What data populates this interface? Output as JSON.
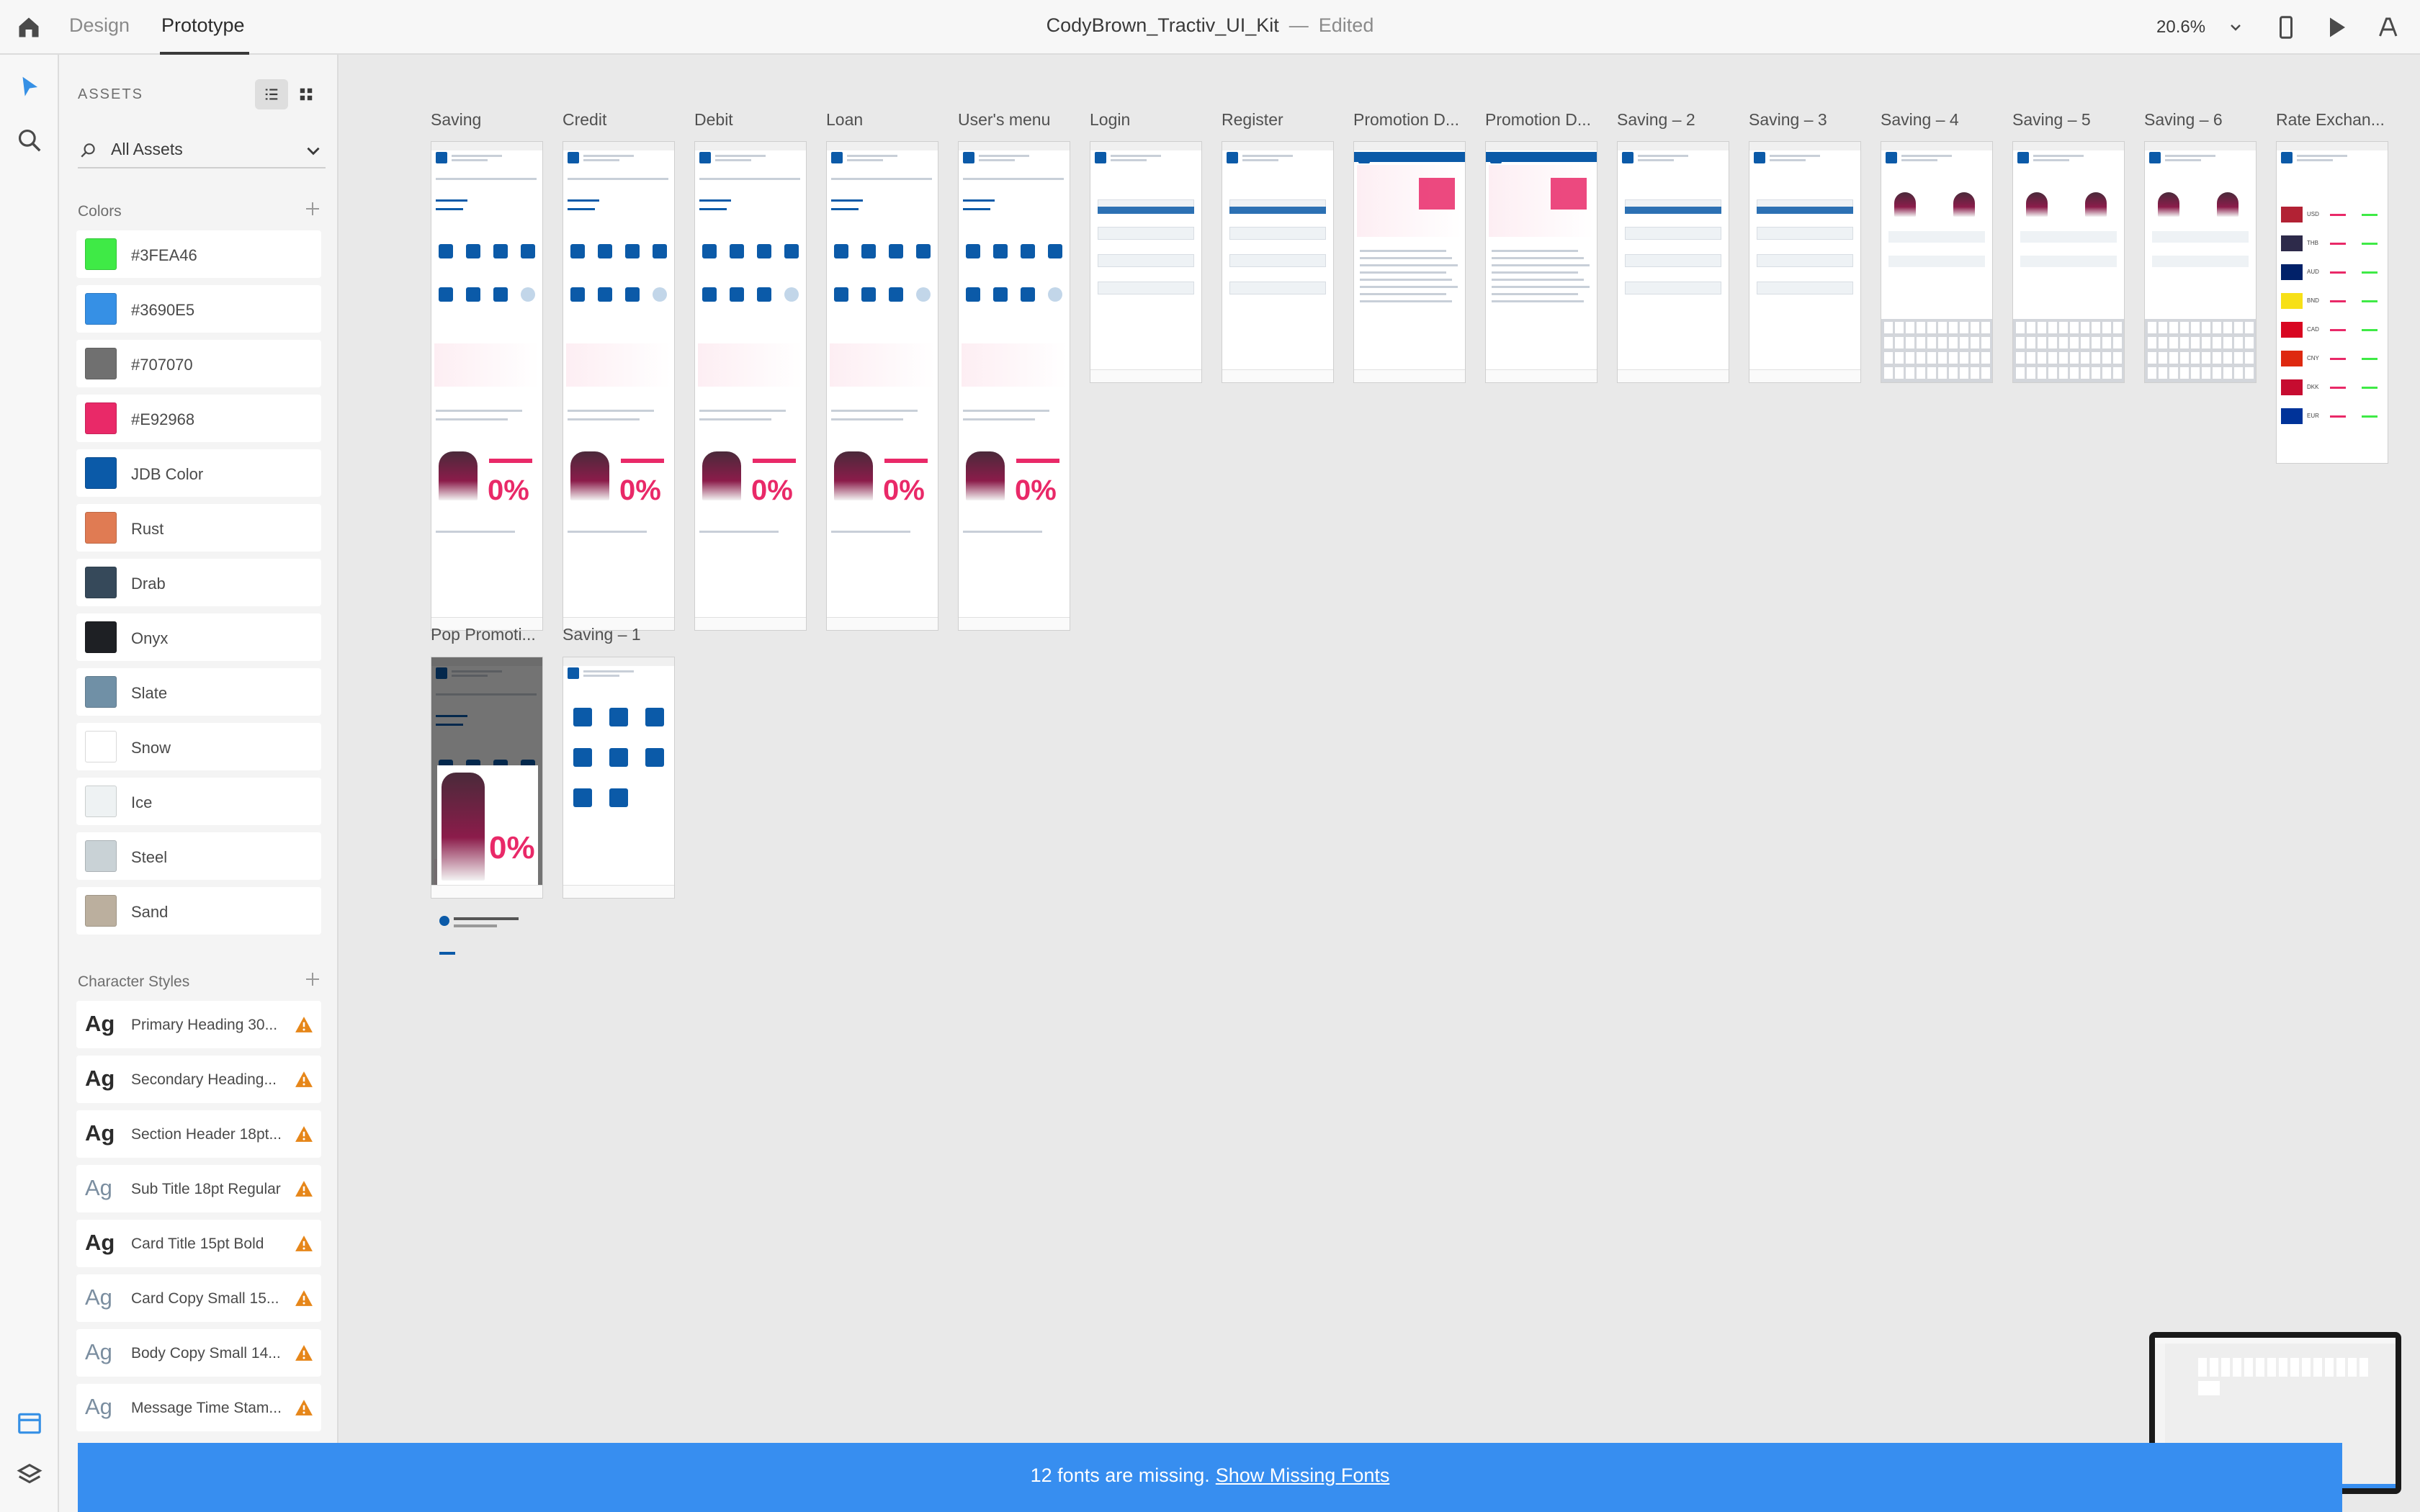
{
  "app": {
    "modes": [
      "Design",
      "Prototype"
    ],
    "active_mode": "Prototype",
    "document_title": "CodyBrown_Tractiv_UI_Kit",
    "separator": "—",
    "document_status": "Edited",
    "zoom": "20.6%"
  },
  "assets_panel": {
    "title": "ASSETS",
    "filter_label": "All Assets",
    "colors_title": "Colors",
    "colors": [
      {
        "label": "#3FEA46",
        "hex": "#3FEA46"
      },
      {
        "label": "#3690E5",
        "hex": "#3690E5"
      },
      {
        "label": "#707070",
        "hex": "#707070"
      },
      {
        "label": "#E92968",
        "hex": "#E92968"
      },
      {
        "label": "JDB Color",
        "hex": "#0B5AA8"
      },
      {
        "label": "Rust",
        "hex": "#E07B53"
      },
      {
        "label": "Drab",
        "hex": "#36495A"
      },
      {
        "label": "Onyx",
        "hex": "#1E2024"
      },
      {
        "label": "Slate",
        "hex": "#7090A6"
      },
      {
        "label": "Snow",
        "hex": "#FFFFFF"
      },
      {
        "label": "Ice",
        "hex": "#EEF2F3"
      },
      {
        "label": "Steel",
        "hex": "#C9D2D6"
      },
      {
        "label": "Sand",
        "hex": "#BBAF9E"
      }
    ],
    "char_styles_title": "Character Styles",
    "char_styles": [
      {
        "sample": "Ag",
        "label": "Primary Heading 30...",
        "weight": "bold"
      },
      {
        "sample": "Ag",
        "label": "Secondary Heading...",
        "weight": "bold"
      },
      {
        "sample": "Ag",
        "label": "Section Header 18pt...",
        "weight": "bold"
      },
      {
        "sample": "Ag",
        "label": "Sub Title 18pt Regular",
        "weight": "light"
      },
      {
        "sample": "Ag",
        "label": "Card Title 15pt Bold",
        "weight": "bold"
      },
      {
        "sample": "Ag",
        "label": "Card Copy Small 15...",
        "weight": "light"
      },
      {
        "sample": "Ag",
        "label": "Body Copy Small 14...",
        "weight": "light"
      },
      {
        "sample": "Ag",
        "label": "Message Time Stam...",
        "weight": "light"
      }
    ]
  },
  "canvas": {
    "artboards_row1": [
      {
        "title": "Saving",
        "kind": "home"
      },
      {
        "title": "Credit",
        "kind": "home"
      },
      {
        "title": "Debit",
        "kind": "home"
      },
      {
        "title": "Loan",
        "kind": "home"
      },
      {
        "title": "User's menu",
        "kind": "home"
      },
      {
        "title": "Login",
        "kind": "form"
      },
      {
        "title": "Register",
        "kind": "form"
      },
      {
        "title": "Promotion D...",
        "kind": "promo"
      },
      {
        "title": "Promotion D...",
        "kind": "promo"
      },
      {
        "title": "Saving – 2",
        "kind": "form"
      },
      {
        "title": "Saving – 3",
        "kind": "form"
      },
      {
        "title": "Saving – 4",
        "kind": "keyboard"
      },
      {
        "title": "Saving – 5",
        "kind": "keyboard"
      },
      {
        "title": "Saving – 6",
        "kind": "keyboard"
      },
      {
        "title": "Rate Exchan...",
        "kind": "rates"
      }
    ],
    "artboards_row2": [
      {
        "title": "Pop Promoti...",
        "kind": "popup"
      },
      {
        "title": "Saving – 1",
        "kind": "menu"
      }
    ],
    "rate_codes": [
      "USD",
      "THB",
      "AUD",
      "BND",
      "CAD",
      "CNY",
      "DKK",
      "EUR"
    ]
  },
  "notification": {
    "text": "12 fonts are missing.",
    "link": "Show Missing Fonts"
  }
}
